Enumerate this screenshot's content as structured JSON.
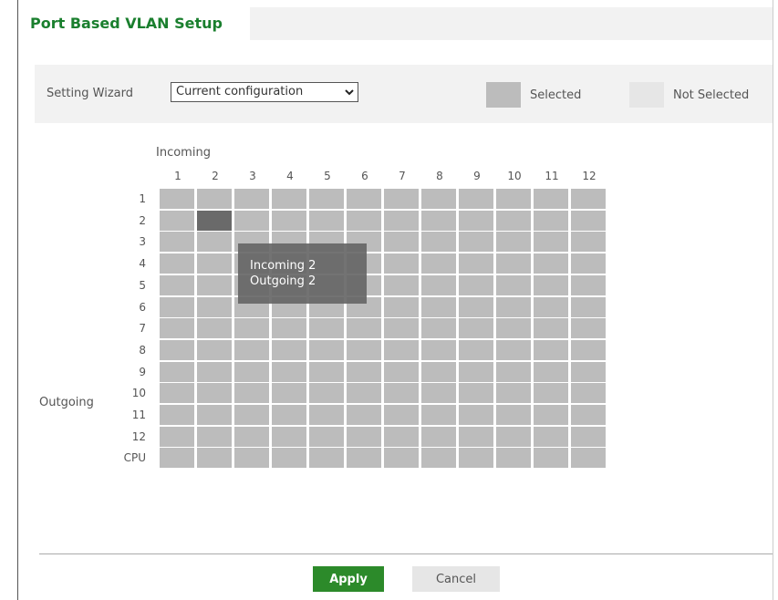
{
  "header": {
    "title": "Port Based VLAN Setup"
  },
  "wizard": {
    "label": "Setting Wizard",
    "selected_option": "Current configuration"
  },
  "legend": {
    "selected_label": "Selected",
    "not_selected_label": "Not Selected",
    "selected_color": "#bcbcbc",
    "not_selected_color": "#e6e6e6",
    "active_cell_color": "#6a6a6a"
  },
  "matrix": {
    "incoming_label": "Incoming",
    "outgoing_label": "Outgoing",
    "incoming_ports": [
      "1",
      "2",
      "3",
      "4",
      "5",
      "6",
      "7",
      "8",
      "9",
      "10",
      "11",
      "12"
    ],
    "outgoing_ports": [
      "1",
      "2",
      "3",
      "4",
      "5",
      "6",
      "7",
      "8",
      "9",
      "10",
      "11",
      "12",
      "CPU"
    ],
    "highlighted_cell": {
      "incoming": "2",
      "outgoing": "2"
    }
  },
  "tooltip": {
    "line1": "Incoming 2",
    "line2": "Outgoing 2"
  },
  "actions": {
    "apply_label": "Apply",
    "cancel_label": "Cancel"
  },
  "colors": {
    "brand_green": "#1a7f2e",
    "apply_green": "#2c8a2a"
  }
}
